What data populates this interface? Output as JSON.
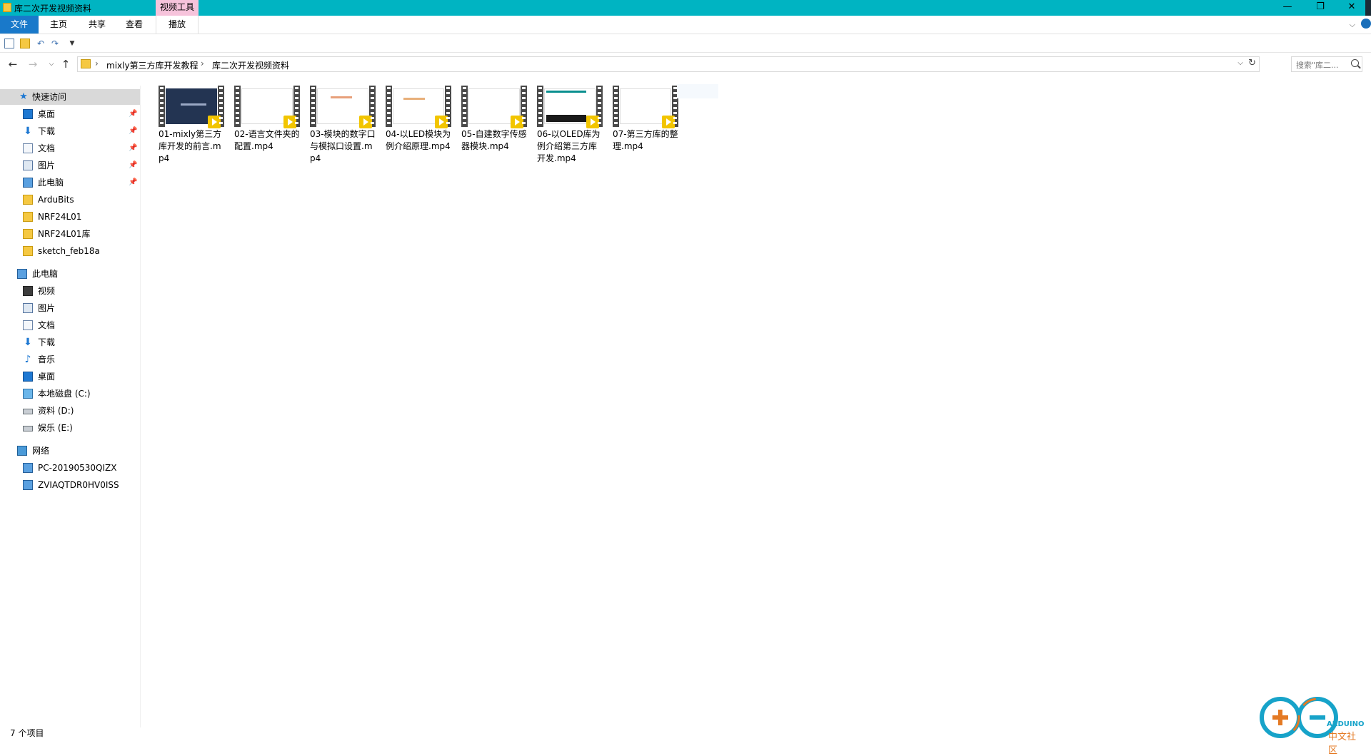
{
  "window": {
    "title": "库二次开发视频资料",
    "context_tab": "视频工具",
    "minimize": "—",
    "maximize": "❐",
    "close": "✕"
  },
  "ribbon": {
    "tabs": [
      {
        "label": "文件"
      },
      {
        "label": "主页"
      },
      {
        "label": "共享"
      },
      {
        "label": "查看"
      },
      {
        "label": "播放"
      }
    ]
  },
  "address": {
    "crumbs": [
      "mixly第三方库开发教程",
      "库二次开发视频资料"
    ],
    "search_placeholder": "搜索\"库二..."
  },
  "sidebar": {
    "quick_access": "快速访问",
    "quick_items": [
      {
        "label": "桌面",
        "icon": "desktop-icon"
      },
      {
        "label": "下载",
        "icon": "download-icon"
      },
      {
        "label": "文档",
        "icon": "document-icon"
      },
      {
        "label": "图片",
        "icon": "picture-icon"
      },
      {
        "label": "此电脑",
        "icon": "pc-icon"
      },
      {
        "label": "ArduBits",
        "icon": "folder-icon"
      },
      {
        "label": "NRF24L01",
        "icon": "folder-icon"
      },
      {
        "label": "NRF24L01库",
        "icon": "folder-icon"
      },
      {
        "label": "sketch_feb18a",
        "icon": "folder-icon"
      }
    ],
    "this_pc": "此电脑",
    "pc_items": [
      {
        "label": "视频",
        "icon": "video-icon"
      },
      {
        "label": "图片",
        "icon": "picture-icon"
      },
      {
        "label": "文档",
        "icon": "document-icon"
      },
      {
        "label": "下载",
        "icon": "download-icon"
      },
      {
        "label": "音乐",
        "icon": "music-icon"
      },
      {
        "label": "桌面",
        "icon": "desktop-icon"
      },
      {
        "label": "本地磁盘 (C:)",
        "icon": "system-drive-icon"
      },
      {
        "label": "资料 (D:)",
        "icon": "drive-icon"
      },
      {
        "label": "娱乐 (E:)",
        "icon": "drive-icon"
      }
    ],
    "network": "网络",
    "network_items": [
      {
        "label": "PC-20190530QIZX",
        "icon": "computer-icon"
      },
      {
        "label": "ZVIAQTDR0HV0ISS",
        "icon": "computer-icon"
      }
    ]
  },
  "files": [
    {
      "name": "01-mixly第三方库开发的前言.mp4"
    },
    {
      "name": "02-语言文件夹的配置.mp4"
    },
    {
      "name": "03-模块的数字口与模拟口设置.mp4"
    },
    {
      "name": "04-以LED模块为例介绍原理.mp4"
    },
    {
      "name": "05-自建数字传感器模块.mp4"
    },
    {
      "name": "06-以OLED库为例介绍第三方库开发.mp4"
    },
    {
      "name": "07-第三方库的整理.mp4"
    }
  ],
  "status": {
    "item_count": "7 个项目"
  },
  "watermark": {
    "brand": "ARDUINO",
    "sub": "中文社区"
  }
}
